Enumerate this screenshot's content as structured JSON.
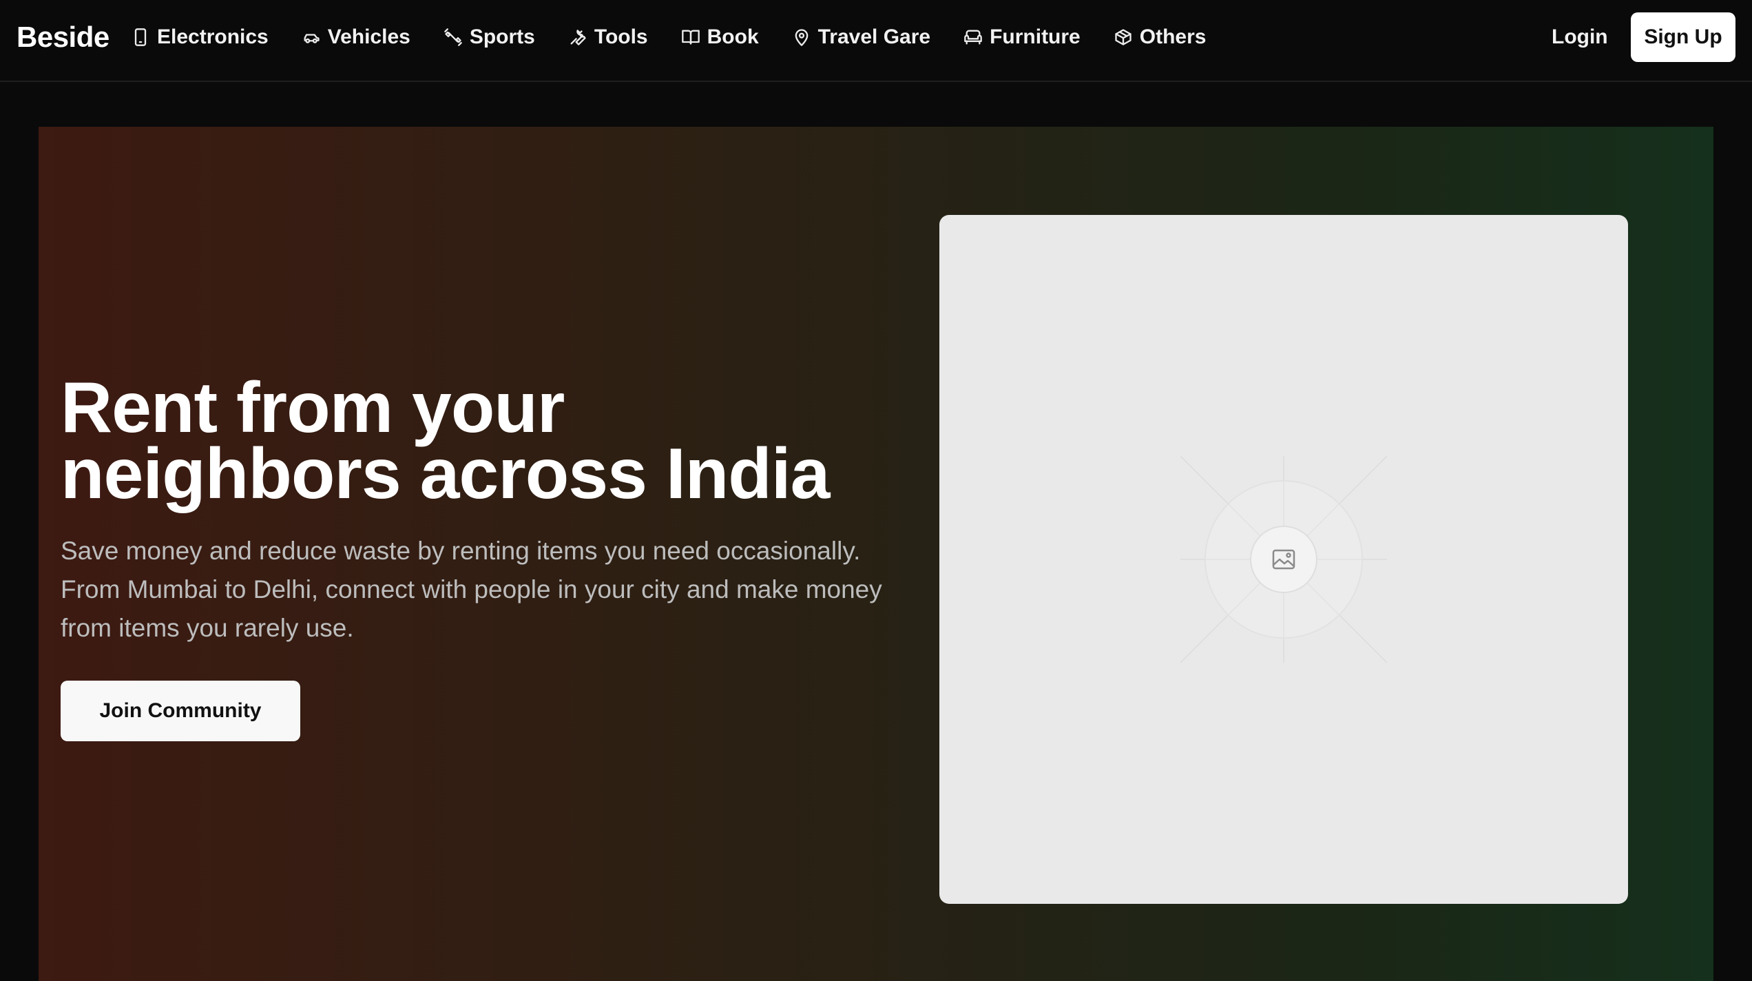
{
  "brand": {
    "name": "Beside"
  },
  "nav": {
    "items": [
      {
        "label": "Electronics",
        "icon": "smartphone-icon"
      },
      {
        "label": "Vehicles",
        "icon": "car-icon"
      },
      {
        "label": "Sports",
        "icon": "dumbbell-icon"
      },
      {
        "label": "Tools",
        "icon": "wrench-icon"
      },
      {
        "label": "Book",
        "icon": "book-open-icon"
      },
      {
        "label": "Travel Gare",
        "icon": "map-pin-icon"
      },
      {
        "label": "Furniture",
        "icon": "sofa-icon"
      },
      {
        "label": "Others",
        "icon": "package-icon"
      }
    ],
    "login_label": "Login",
    "signup_label": "Sign Up"
  },
  "hero": {
    "title_line1": "Rent from your",
    "title_line2": "neighbors across India",
    "description": "Save money and reduce waste by renting items you need occasionally. From Mumbai to Delhi, connect with people in your city and make money from items you rarely use.",
    "cta_label": "Join Community",
    "image_icon": "image-icon"
  },
  "colors": {
    "background": "#0a0a0a",
    "hero_gradient_start": "#3d1a12",
    "hero_gradient_end": "#15301c",
    "placeholder_bg": "#e9e9e9",
    "button_bg": "#ffffff",
    "muted_text": "#bdbdbd"
  }
}
